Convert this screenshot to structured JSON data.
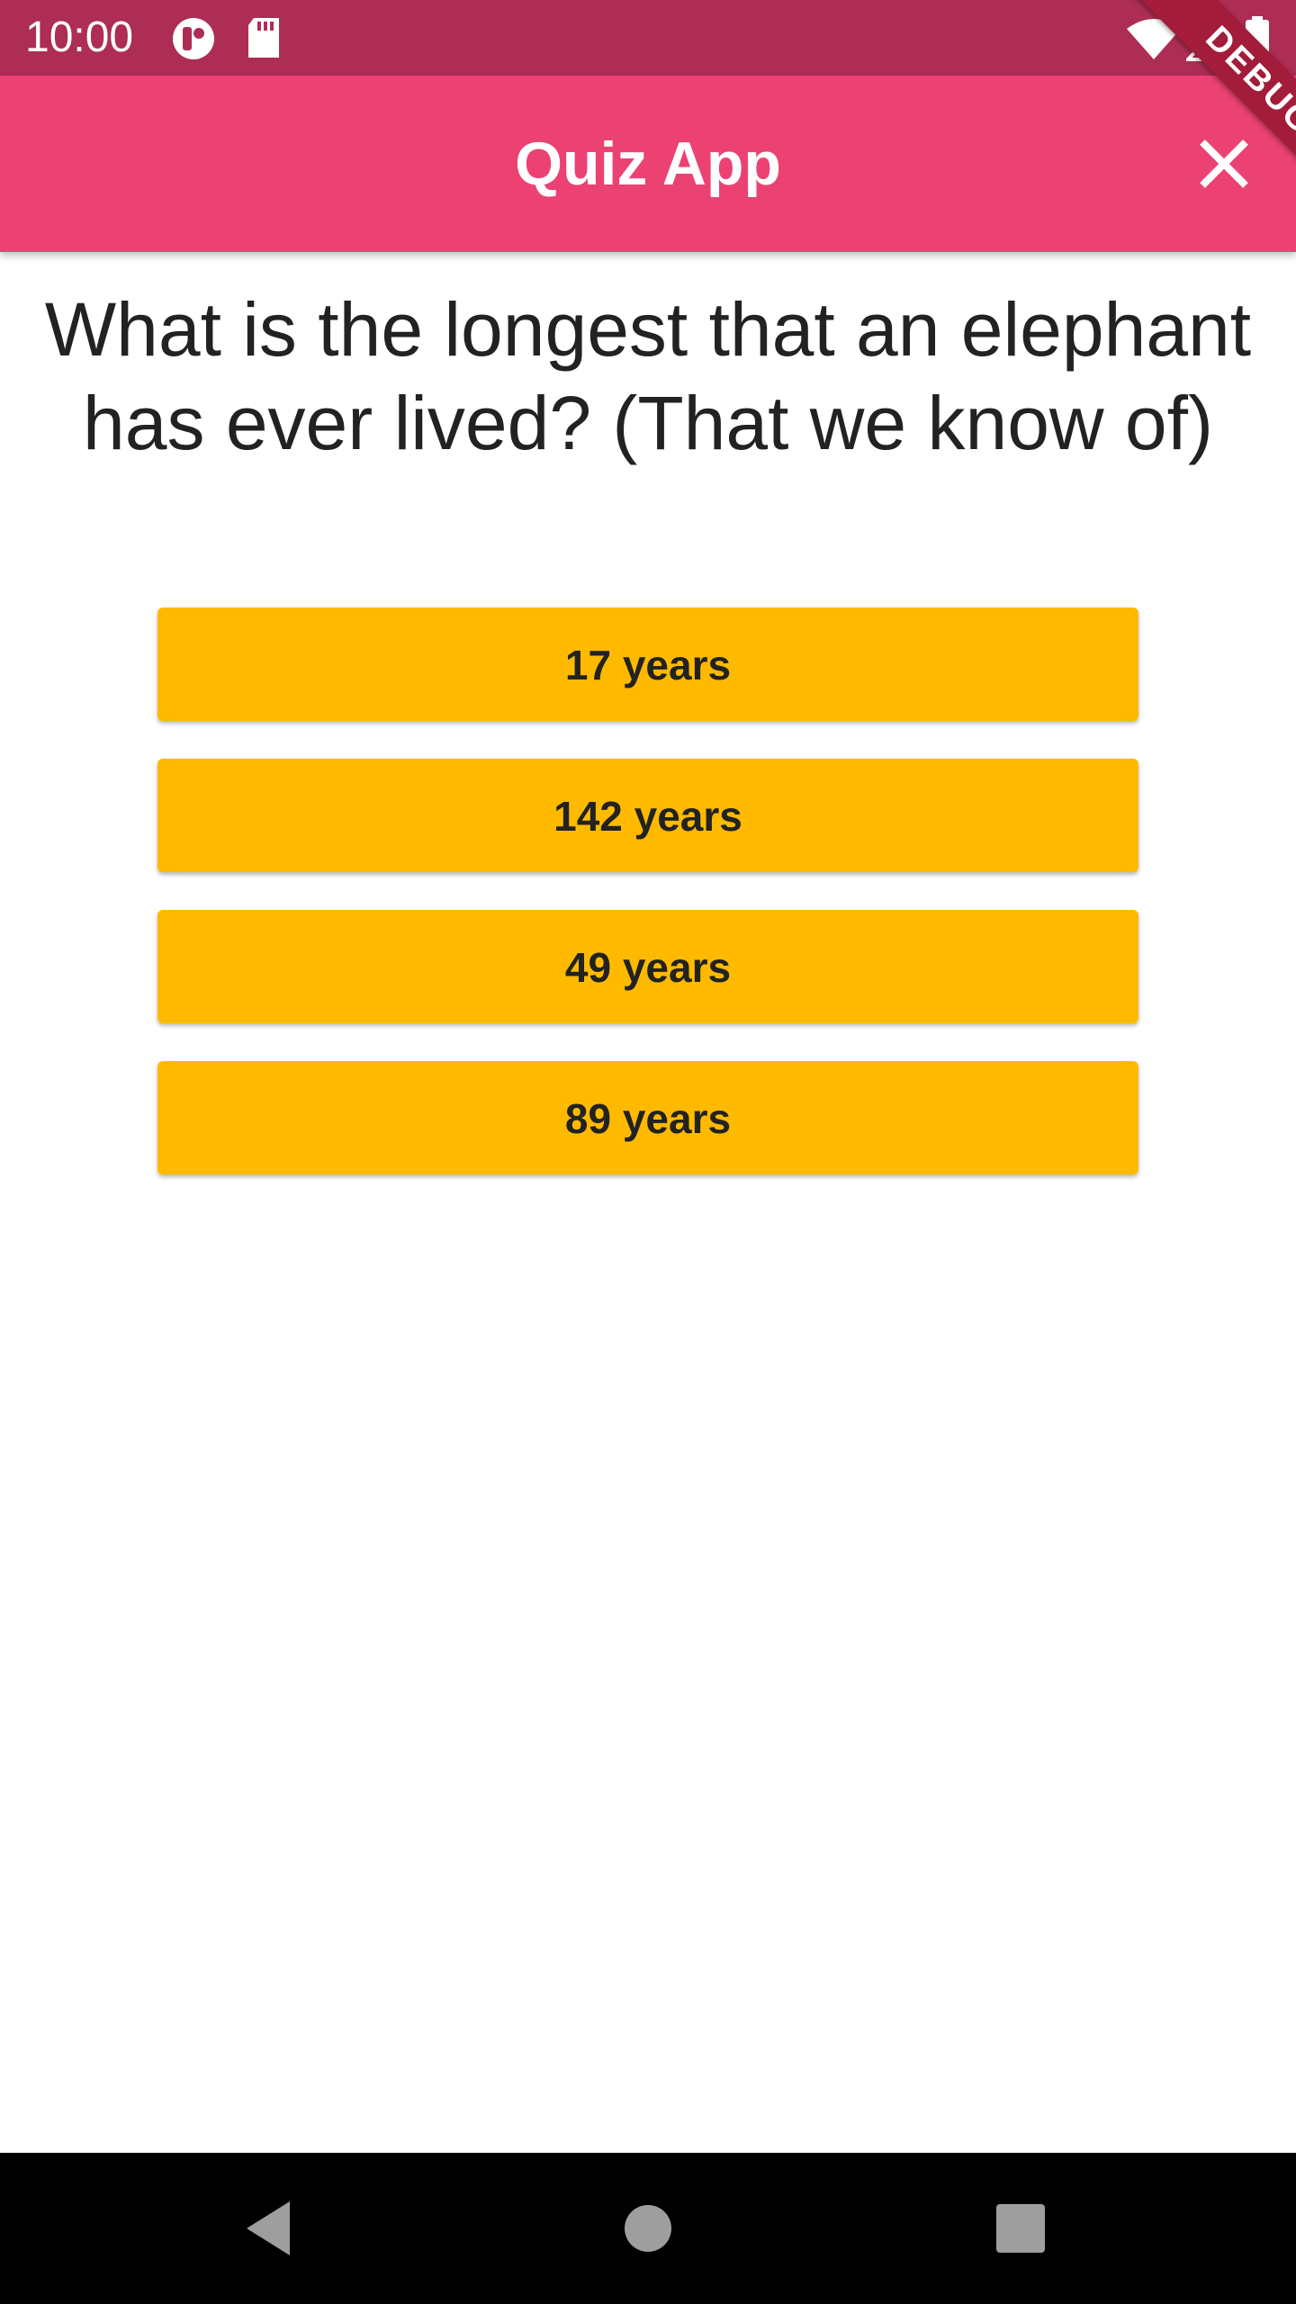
{
  "status_bar": {
    "time": "10:00",
    "icons": [
      "media-icon",
      "sd-card-icon",
      "wifi-icon",
      "signal-icon",
      "battery-icon"
    ],
    "color": "#ad2d55"
  },
  "app_bar": {
    "title": "Quiz App",
    "close_icon": "close-icon",
    "color": "#eb4273"
  },
  "debug_banner": "DEBUG",
  "quiz": {
    "question": "What is the longest that an elephant has ever lived? (That we know of)",
    "answers": [
      {
        "label": "17 years"
      },
      {
        "label": "142 years"
      },
      {
        "label": "49 years"
      },
      {
        "label": "89 years"
      }
    ],
    "answer_color": "#ffba00"
  },
  "nav_bar": {
    "icons": [
      "back-icon",
      "home-icon",
      "recents-icon"
    ]
  }
}
